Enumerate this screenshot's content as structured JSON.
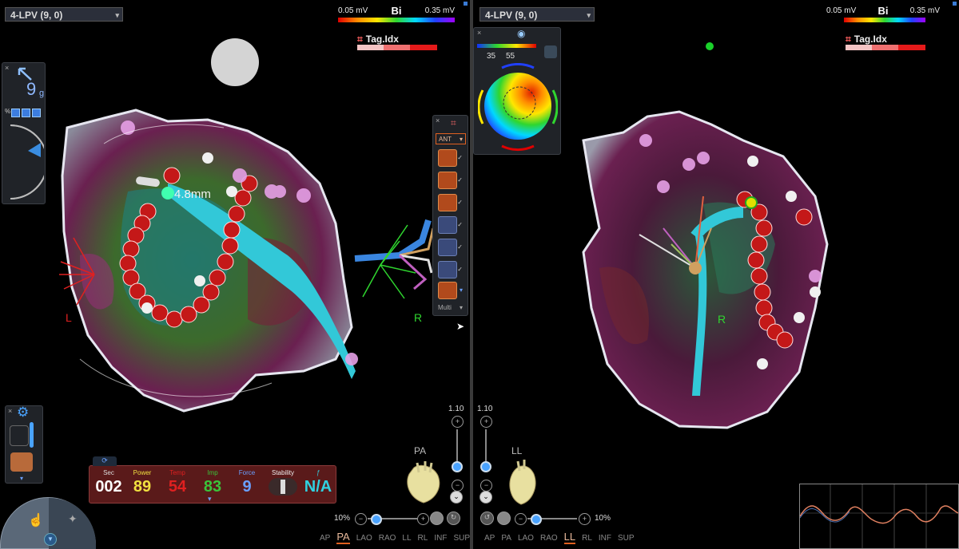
{
  "left": {
    "map_select": "4-LPV (9, 0)",
    "scale": {
      "low": "0.05 mV",
      "title": "Bi",
      "high": "0.35 mV"
    },
    "tag_label": "Tag.Idx",
    "measure_label": "4.8mm",
    "orient_left": "L",
    "orient_right": "R",
    "force_value": "9",
    "force_unit": "g",
    "force_pct": "%",
    "toolbar_dropdown": "ANT",
    "toolbar_multi": "Multi",
    "stats": {
      "sec_label": "Sec",
      "sec_value": "002",
      "power_label": "Power",
      "power_value": "89",
      "temp_label": "Temp",
      "temp_value": "54",
      "imp_label": "Imp",
      "imp_value": "83",
      "force_label": "Force",
      "force_value": "9",
      "stability_label": "Stability",
      "ff_label": "ƒ",
      "ff_value": "N/A"
    },
    "zoom_top": "1.10",
    "view_label": "PA",
    "zoom_pct": "10%",
    "views": [
      "AP",
      "PA",
      "LAO",
      "RAO",
      "LL",
      "RL",
      "INF",
      "SUP"
    ],
    "active_view": "PA"
  },
  "right": {
    "map_select": "4-LPV (9, 0)",
    "scale": {
      "low": "0.05 mV",
      "title": "Bi",
      "high": "0.35 mV"
    },
    "tag_label": "Tag.Idx",
    "bullseye_min": "35",
    "bullseye_max": "55",
    "orient_right": "R",
    "zoom_top": "1.10",
    "view_label": "LL",
    "zoom_pct": "10%",
    "views": [
      "AP",
      "PA",
      "LAO",
      "RAO",
      "LL",
      "RL",
      "INF",
      "SUP"
    ],
    "active_view": "LL"
  },
  "colors": {
    "background": "#000000",
    "catheter": "#32c8d8",
    "lesion": "#c41818",
    "power": "#f0e040",
    "temp": "#e02020",
    "imp": "#3ac43a",
    "force": "#6aa0ff",
    "ff": "#30d0e0"
  },
  "icons": {
    "arrow": "pointer-arrow-icon",
    "settings": "gear-icon",
    "camera": "camera-icon",
    "close": "close-icon"
  }
}
